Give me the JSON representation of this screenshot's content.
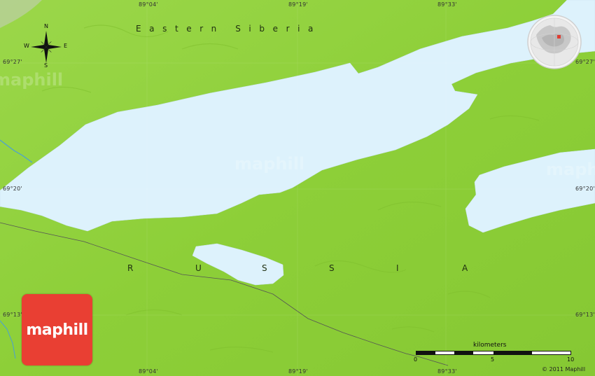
{
  "map": {
    "region_label": "Eastern Siberia",
    "country_label": "RUSSIA",
    "country_letters": [
      "R",
      "U",
      "S",
      "S",
      "I",
      "A"
    ],
    "watermark": "maphill",
    "colors": {
      "land": "#8fd13a",
      "water": "#ddf2fc",
      "river": "#4a9fd6",
      "road": "#555555",
      "logo_bg": "#e93f33",
      "globe_highlight": "#e03c31"
    },
    "coordinates": {
      "top_longitudes": [
        "89°04'",
        "89°19'",
        "89°33'"
      ],
      "bottom_longitudes": [
        "89°04'",
        "89°19'",
        "89°33'"
      ],
      "left_latitudes": [
        "69°27'",
        "69°20'",
        "69°13'"
      ],
      "right_latitudes": [
        "69°27'",
        "69°20'",
        "69°13'"
      ]
    },
    "compass": {
      "north": "N",
      "south": "S",
      "east": "E",
      "west": "W"
    },
    "scale": {
      "title": "kilometers",
      "ticks": [
        "0",
        "5",
        "10"
      ]
    },
    "logo_text": "maphill",
    "copyright": "© 2011 Maphill",
    "icons": [
      "compass-rose-icon",
      "globe-locator-icon"
    ]
  }
}
